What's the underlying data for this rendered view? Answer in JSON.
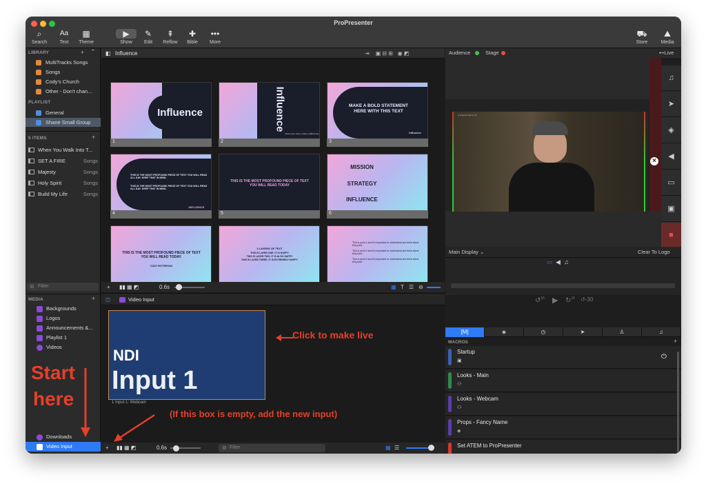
{
  "app": {
    "title": "ProPresenter"
  },
  "toolbar": {
    "search": "Search",
    "text": "Text",
    "theme": "Theme",
    "show": "Show",
    "edit": "Edit",
    "reflow": "Reflow",
    "bible": "Bible",
    "more": "More",
    "store": "Store",
    "media": "Media"
  },
  "sidebar": {
    "library_header": "LIBRARY",
    "library_items": [
      "MultiTracks Songs",
      "Songs",
      "Cody's Church",
      "Other - Don't chan..."
    ],
    "playlist_header": "PLAYLIST",
    "playlist_items": [
      "General",
      "Shane Small Group"
    ],
    "items_header": "5 ITEMS",
    "items": [
      {
        "name": "When You Walk Into T...",
        "type": ""
      },
      {
        "name": "SET A FIRE",
        "type": "Songs"
      },
      {
        "name": "Majesty",
        "type": "Songs"
      },
      {
        "name": "Holy Spirit",
        "type": "Songs"
      },
      {
        "name": "Build My Life",
        "type": "Songs"
      }
    ],
    "filter_placeholder": "Filter",
    "media_header": "MEDIA",
    "media_items": [
      "Backgrounds",
      "Logos",
      "Announcements &...",
      "Playlist 1",
      "Videos"
    ],
    "bottom_items": [
      "Downloads",
      "Video Input"
    ]
  },
  "presentation": {
    "title": "Influence",
    "slides": [
      {
        "num": "1",
        "text": "Influence"
      },
      {
        "num": "2",
        "text": "Influence",
        "sub": "show your story, make a difference"
      },
      {
        "num": "3",
        "text": "MAKE A BOLD STATEMENT HERE WITH THIS TEXT",
        "sub": "Influence"
      },
      {
        "num": "4",
        "text": "THIS IS THE MOST PROFOUND PIECE OF TEXT YOU WILL READ ALL DAY. KEEP THAT IN MIND.",
        "text2": "THIS IS THE MOST PROFOUND PIECE OF TEXT YOU WILL READ ALL DAY. KEEP THAT IN MIND.",
        "sub": "INFLUENCE"
      },
      {
        "num": "5",
        "text": "THIS IS THE MOST PROFOUND PIECE OF TEXT YOU WILL READ TODAY"
      },
      {
        "num": "6",
        "text": "MISSION",
        "text2": "STRATEGY",
        "text3": "INFLUENCE"
      },
      {
        "num": "7",
        "text": "THIS IS THE MOST PROFOUND PIECE OF TEXT YOU WILL READ TODAY.",
        "sub": "CODY PATTERSON"
      },
      {
        "num": "8",
        "text": "3 LAYERS OF TEXT",
        "text2": "THIS IS LAYER ONE. IT IS HAPPY",
        "text3": "THIS IS LAYER TWO. IT IS ALSO HAPPY",
        "text4": "THIS IS LAYER THREE. IT IS EXTREMELY HAPPY"
      },
      {
        "num": "9",
        "text": "This is point 1 and it's important to understand and think about this point.",
        "text2": "This is point 2 and it's important to understand and think about this point.",
        "text3": "This is point 3 and it's important to understand and think about this point."
      }
    ],
    "transition_time": "0.6s"
  },
  "video_input": {
    "header": "Video Input",
    "tile_line1": "NDI",
    "tile_line2": "Input 1",
    "tile_caption": "1 Input 1: Webcam",
    "transition_time": "0.6s",
    "filter_placeholder": "Filter"
  },
  "right": {
    "audience": "Audience",
    "stage": "Stage",
    "live": "Live",
    "main_display": "Main Display",
    "clear_to_logo": "Clear To Logo",
    "skip_back": "15",
    "skip_fwd": "15",
    "skip_back2": "-30"
  },
  "macros": {
    "header": "MACROS",
    "tab_m": "[M]",
    "items": [
      {
        "name": "Startup",
        "color": "#3a63b0"
      },
      {
        "name": "Looks - Main",
        "color": "#2f8a4c"
      },
      {
        "name": "Looks - Webcam",
        "color": "#5a3fa8"
      },
      {
        "name": "Props - Fancy Name",
        "color": "#5a3fa8"
      },
      {
        "name": "Set ATEM to ProPresenter",
        "color": "#d53a2a"
      }
    ]
  },
  "annotations": {
    "click_live": "Click to make live",
    "start": "Start",
    "here": "here",
    "empty_box": "(If this box is empty, add the new input)"
  },
  "colors": {
    "accent": "#2f7bf5",
    "annotation": "#e5402a",
    "audience_dot": "#3ec44f",
    "stage_dot": "#e84b4b"
  }
}
